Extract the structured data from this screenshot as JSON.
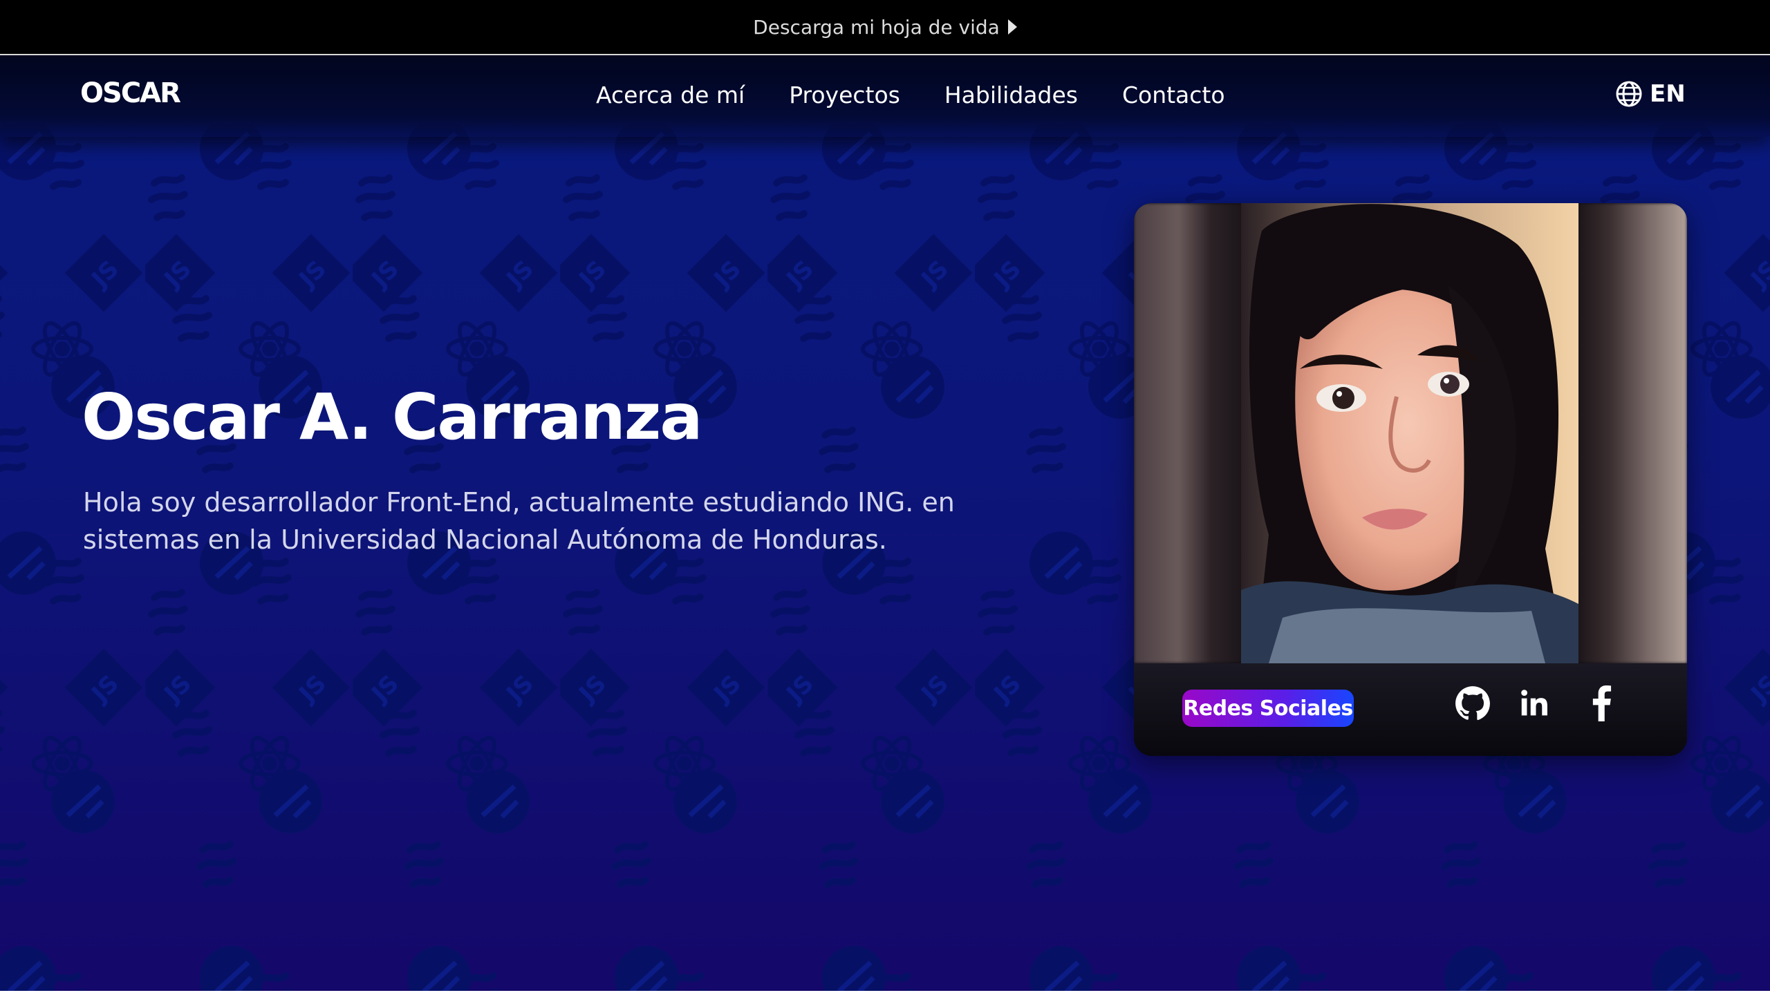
{
  "banner": {
    "label": "Descarga mi hoja de vida"
  },
  "nav": {
    "logo": "OSCAR",
    "links": [
      {
        "label": "Acerca de mí"
      },
      {
        "label": "Proyectos"
      },
      {
        "label": "Habilidades"
      },
      {
        "label": "Contacto"
      }
    ],
    "language": {
      "label": "EN",
      "icon": "globe-icon"
    }
  },
  "hero": {
    "name": "Oscar A. Carranza",
    "description": "Hola soy desarrollador Front-End, actualmente estudiando ING. en sistemas en la Universidad Nacional Autónoma de Honduras."
  },
  "profile_card": {
    "social_label": "Redes Sociales",
    "social_icons": [
      "github-icon",
      "linkedin-icon",
      "facebook-icon"
    ]
  },
  "colors": {
    "background_top": "#081a7e",
    "background_bottom": "#14086a",
    "badge_start": "#9a08c8",
    "badge_end": "#1846ff"
  }
}
